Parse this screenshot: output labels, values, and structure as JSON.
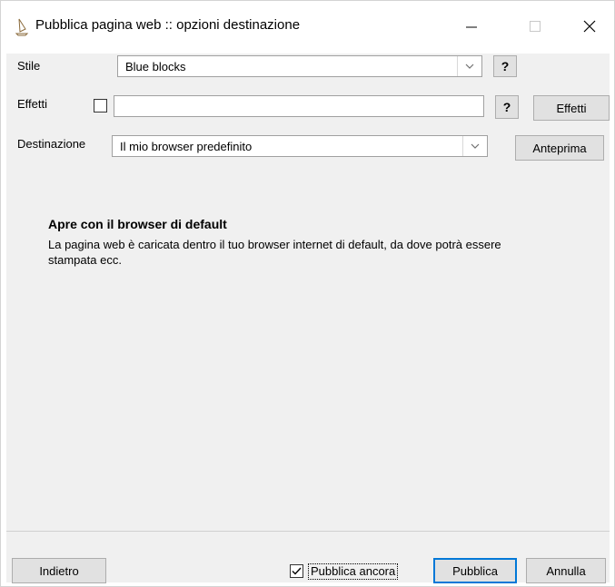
{
  "window": {
    "title": "Pubblica pagina web :: opzioni destinazione",
    "icon": "publish-icon"
  },
  "form": {
    "style_label": "Stile",
    "style_value": "Blue blocks",
    "effects_label": "Effetti",
    "effects_checked": false,
    "effects_value": "",
    "destination_label": "Destinazione",
    "destination_value": "Il mio browser predefinito",
    "help_label": "?",
    "effects_button": "Effetti",
    "preview_button": "Anteprima"
  },
  "info": {
    "heading": "Apre con il browser di default",
    "description": "La pagina web è caricata dentro il tuo browser internet di default, da dove potrà essere stampata ecc."
  },
  "footer": {
    "back_button": "Indietro",
    "publish_again_label": "Pubblica ancora",
    "publish_again_checked": true,
    "publish_button": "Pubblica",
    "cancel_button": "Annulla"
  },
  "colors": {
    "accent": "#0078d7",
    "client_bg": "#f0f0f0"
  }
}
